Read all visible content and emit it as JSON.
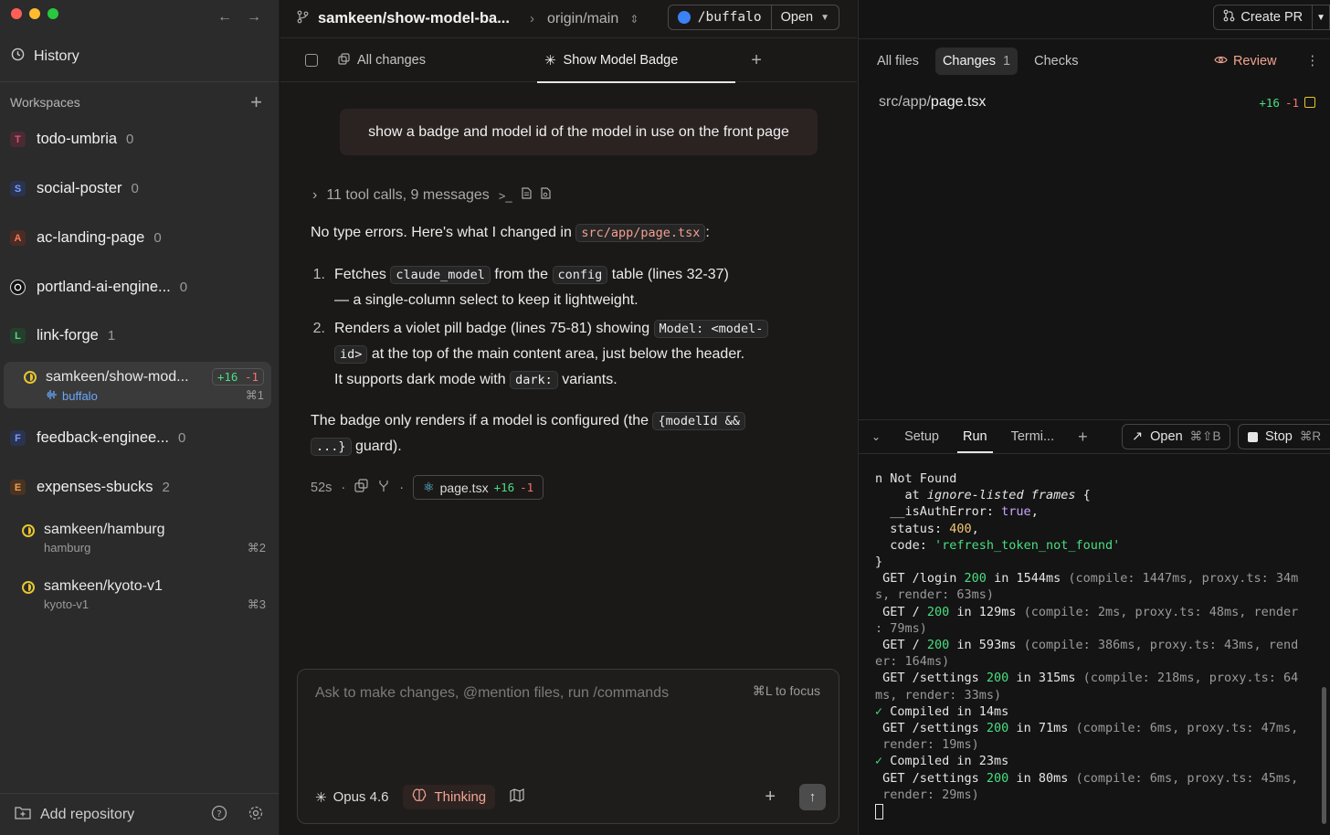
{
  "sidebar": {
    "history_label": "History",
    "workspaces_label": "Workspaces",
    "repos": [
      {
        "badge": "T",
        "name": "todo-umbria",
        "count": "0",
        "color": "#d9536f",
        "bg": "#4a2a33"
      },
      {
        "badge": "S",
        "name": "social-poster",
        "count": "0",
        "color": "#7b9cff",
        "bg": "#2a3350"
      },
      {
        "badge": "A",
        "name": "ac-landing-page",
        "count": "0",
        "color": "#f07a5a",
        "bg": "#4a2c24"
      },
      {
        "badge": "",
        "name": "portland-ai-engine...",
        "count": "0",
        "color": "#ffffff",
        "bg": "#111111"
      },
      {
        "badge": "L",
        "name": "link-forge",
        "count": "1",
        "color": "#6ad08a",
        "bg": "#23402d"
      },
      {
        "badge": "F",
        "name": "feedback-enginee...",
        "count": "0",
        "color": "#7b9cff",
        "bg": "#2a3350"
      },
      {
        "badge": "E",
        "name": "expenses-sbucks",
        "count": "2",
        "color": "#f0a050",
        "bg": "#4a3320"
      }
    ],
    "active_branch": {
      "name": "samkeen/show-mod...",
      "add": "+16",
      "del": "-1",
      "sub": "buffalo",
      "shortcut": "⌘1"
    },
    "branches": [
      {
        "name": "samkeen/hamburg",
        "sub": "hamburg",
        "shortcut": "⌘2"
      },
      {
        "name": "samkeen/kyoto-v1",
        "sub": "kyoto-v1",
        "shortcut": "⌘3"
      }
    ],
    "add_repository": "Add repository"
  },
  "topbar": {
    "branch": "samkeen/show-model-ba...",
    "origin": "origin/main",
    "location": "/buffalo",
    "open_label": "Open"
  },
  "tabs": {
    "all_changes": "All changes",
    "show_model_badge": "Show Model Badge"
  },
  "chat": {
    "prompt": "show a badge and model id of the model in use on the front page",
    "tool_calls": "11 tool calls, 9 messages",
    "intro_text": "No type errors. Here's what I changed in",
    "intro_path": "src/app/page.tsx",
    "item1_num": "1.",
    "item1_a": "Fetches",
    "item1_code1": "claude_model",
    "item1_b": "from the",
    "item1_code2": "config",
    "item1_c": "table (lines 32-37)",
    "item1_d": "— a single-column select to keep it lightweight.",
    "item2_num": "2.",
    "item2_a": "Renders a violet pill badge",
    "item2_b": "(lines 75-81) showing",
    "item2_code1": "Model: <model-",
    "item2_code1b": "id>",
    "item2_c": "at the top of the main content area, just below the header.",
    "item2_d": "It supports dark mode with",
    "item2_code2": "dark:",
    "item2_e": "variants.",
    "outro_a": "The badge only renders if a model is configured (the",
    "outro_code1": "{modelId &&",
    "outro_code2": "...}",
    "outro_b": "guard).",
    "elapsed": "52s",
    "chip_file": "page.tsx",
    "chip_add": "+16",
    "chip_del": "-1"
  },
  "composer": {
    "placeholder": "Ask to make changes, @mention files, run /commands",
    "focus_hint": "⌘L to focus",
    "model": "Opus 4.6",
    "thinking": "Thinking"
  },
  "right": {
    "create_pr": "Create PR",
    "tabs": {
      "all_files": "All files",
      "changes": "Changes",
      "changes_count": "1",
      "checks": "Checks",
      "review": "Review"
    },
    "file": {
      "dir": "src/app/",
      "name": "page.tsx",
      "add": "+16",
      "del": "-1"
    },
    "term_tabs": {
      "setup": "Setup",
      "run": "Run",
      "terminal": "Termi...",
      "open": "Open",
      "open_kb": "⌘⇧B",
      "stop": "Stop",
      "stop_kb": "⌘R"
    }
  }
}
